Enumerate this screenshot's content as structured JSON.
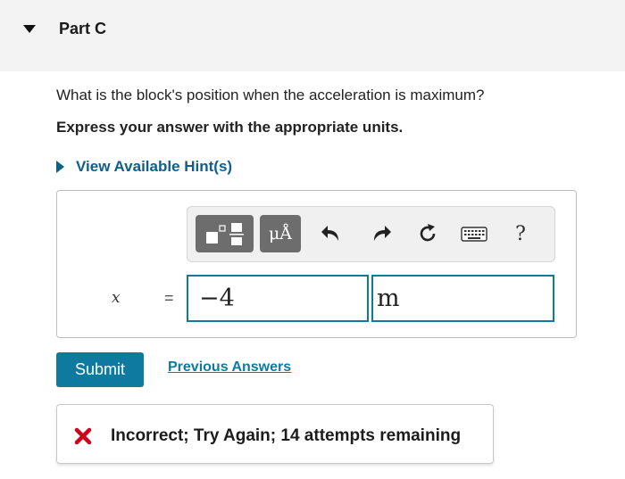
{
  "part": {
    "title": "Part C"
  },
  "question": {
    "text": "What is the block's position when the acceleration is maximum?",
    "instruction": "Express your answer with the appropriate units."
  },
  "hint": {
    "label": "View Available Hint(s)"
  },
  "toolbar": {
    "units_label": "μÅ",
    "help_label": "?"
  },
  "answer": {
    "variable": "x",
    "equals": "=",
    "value": "−4",
    "unit": "m"
  },
  "actions": {
    "submit_label": "Submit",
    "previous_answers_label": "Previous Answers"
  },
  "feedback": {
    "message": "Incorrect; Try Again; 14 attempts remaining",
    "status_color": "#d0021b"
  },
  "colors": {
    "accent": "#0e7aa0",
    "link": "#0e5f8a",
    "toolbar_button": "#6d6d6d"
  }
}
